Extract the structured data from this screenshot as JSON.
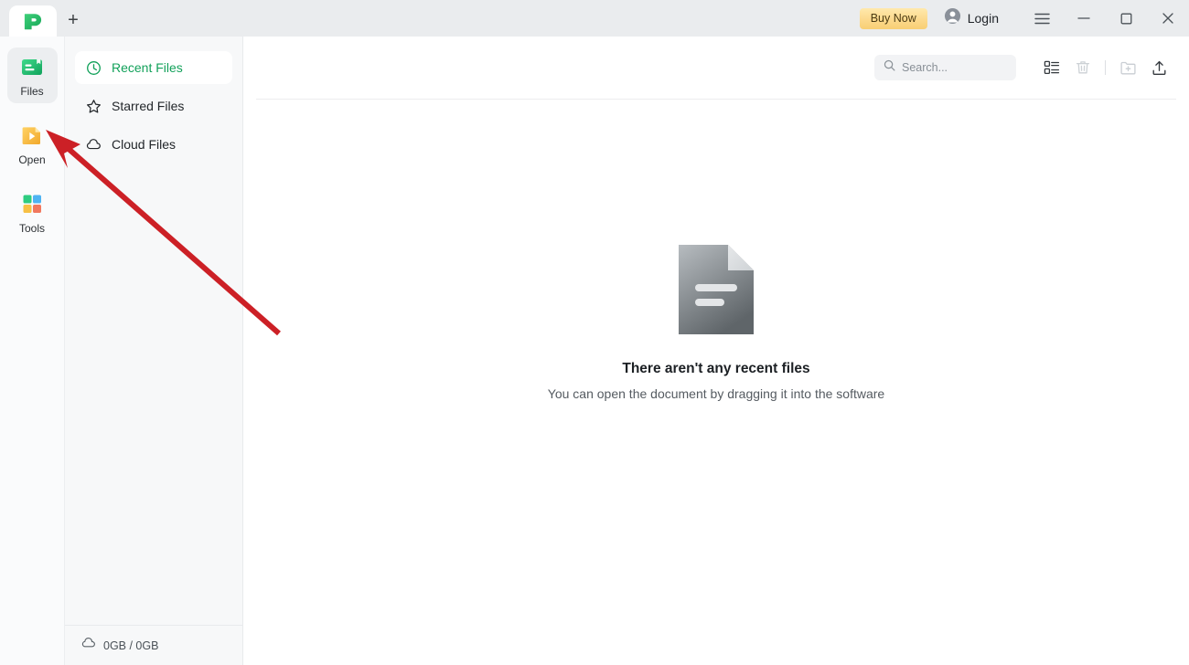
{
  "window": {
    "tab_logo_name": "app-logo",
    "new_tab_label": "+",
    "buy_now_label": "Buy Now",
    "login_label": "Login",
    "menu_icon": "hamburger-menu-icon",
    "minimize_icon": "minimize-icon",
    "maximize_icon": "maximize-icon",
    "close_icon": "close-icon"
  },
  "rail": {
    "items": [
      {
        "label": "Files",
        "icon": "files-icon",
        "selected": true
      },
      {
        "label": "Open",
        "icon": "open-icon",
        "selected": false
      },
      {
        "label": "Tools",
        "icon": "tools-icon",
        "selected": false
      }
    ]
  },
  "nav": {
    "items": [
      {
        "label": "Recent Files",
        "icon": "clock-icon",
        "selected": true
      },
      {
        "label": "Starred Files",
        "icon": "star-icon",
        "selected": false
      },
      {
        "label": "Cloud Files",
        "icon": "cloud-icon",
        "selected": false
      }
    ],
    "storage": {
      "icon": "cloud-icon",
      "text": "0GB / 0GB"
    }
  },
  "toolbar": {
    "search_placeholder": "Search...",
    "search_value": "",
    "list_view_label": "list-view",
    "delete_label": "delete",
    "new_folder_label": "new-folder",
    "upload_label": "upload"
  },
  "empty_state": {
    "icon": "empty-document-icon",
    "title": "There aren't any recent files",
    "subtitle": "You can open the document by dragging it into the software"
  },
  "annotation": {
    "arrow_color": "#cc2026",
    "points_to": "Open"
  },
  "colors": {
    "accent_green": "#12a15a",
    "buy_now_gold": "#fcd98c",
    "annotation_red": "#cc2026",
    "titlebar_bg": "#eaecee",
    "nav_bg": "#f7f8f9"
  }
}
